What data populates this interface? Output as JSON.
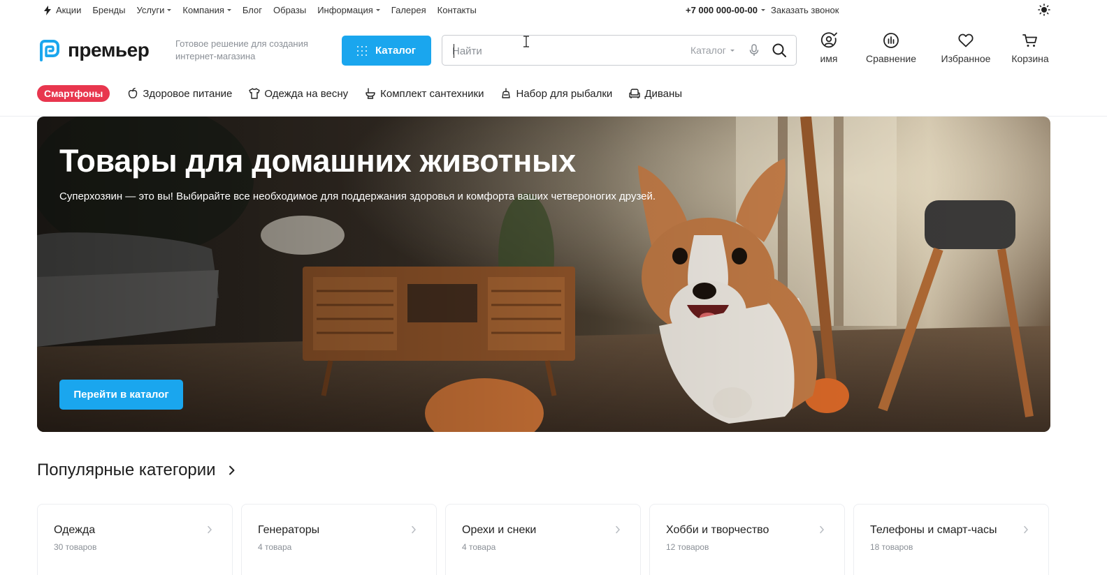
{
  "topnav": {
    "items": [
      {
        "label": "Акции",
        "dropdown": false,
        "icon": "bolt-icon"
      },
      {
        "label": "Бренды",
        "dropdown": false
      },
      {
        "label": "Услуги",
        "dropdown": true
      },
      {
        "label": "Компания",
        "dropdown": true
      },
      {
        "label": "Блог",
        "dropdown": false
      },
      {
        "label": "Образы",
        "dropdown": false
      },
      {
        "label": "Информация",
        "dropdown": true
      },
      {
        "label": "Галерея",
        "dropdown": false
      },
      {
        "label": "Контакты",
        "dropdown": false
      }
    ],
    "phone": "+7 000 000-00-00",
    "callback": "Заказать звонок",
    "theme_icon": "sun-icon"
  },
  "header": {
    "brand": "премьер",
    "tagline": "Готовое решение для создания интернет-магазина",
    "catalog_button": "Каталог",
    "search": {
      "placeholder": "Найти",
      "value": "",
      "scope": "Каталог"
    },
    "actions": [
      {
        "label": "имя",
        "icon": "user-icon"
      },
      {
        "label": "Сравнение",
        "icon": "compare-chart-icon"
      },
      {
        "label": "Избранное",
        "icon": "heart-icon"
      },
      {
        "label": "Корзина",
        "icon": "cart-icon"
      }
    ]
  },
  "tags": {
    "hot": "Смартфоны",
    "items": [
      {
        "label": "Здоровое питание",
        "icon": "apple-icon"
      },
      {
        "label": "Одежда на весну",
        "icon": "shirt-icon"
      },
      {
        "label": "Комплект сантехники",
        "icon": "toilet-icon"
      },
      {
        "label": "Набор для рыбалки",
        "icon": "fishing-icon"
      },
      {
        "label": "Диваны",
        "icon": "sofa-icon"
      }
    ]
  },
  "banner": {
    "title": "Товары для домашних животных",
    "subtitle": "Суперхозяин — это вы! Выбирайте все необходимое для поддержания здоровья и комфорта ваших четвероногих друзей.",
    "cta": "Перейти в каталог"
  },
  "popular": {
    "title": "Популярные категории",
    "categories": [
      {
        "name": "Одежда",
        "count": "30 товаров"
      },
      {
        "name": "Генераторы",
        "count": "4 товара"
      },
      {
        "name": "Орехи и снеки",
        "count": "4 товара"
      },
      {
        "name": "Хобби и творчество",
        "count": "12 товаров"
      },
      {
        "name": "Телефоны и смарт-часы",
        "count": "18 товаров"
      }
    ]
  },
  "colors": {
    "accent": "#1aa6ee",
    "hot_tag": "#e8364e",
    "logo": "#1aa6ee"
  }
}
